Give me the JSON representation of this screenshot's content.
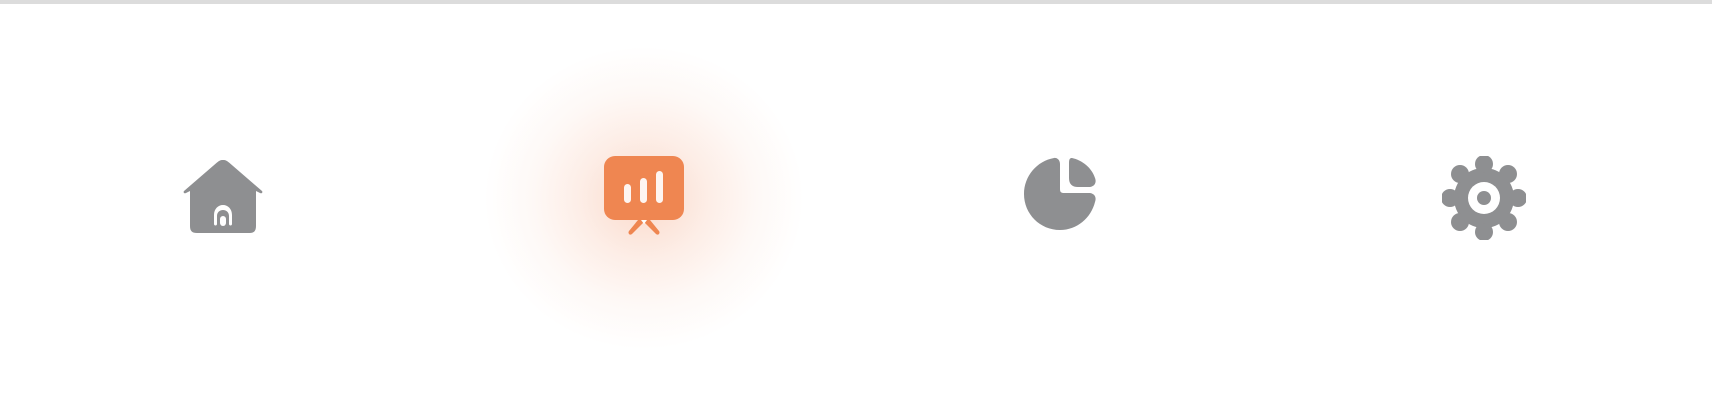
{
  "colors": {
    "inactive_icon": "#8e8f91",
    "active_icon": "#ef8651",
    "divider": "#dcdcdc",
    "background": "#ffffff"
  },
  "tab_bar": {
    "active_tab": "presentation",
    "tabs": [
      {
        "id": "home",
        "icon": "home-icon",
        "active": false
      },
      {
        "id": "presentation",
        "icon": "presentation-chart-icon",
        "active": true
      },
      {
        "id": "analytics",
        "icon": "pie-chart-icon",
        "active": false
      },
      {
        "id": "settings",
        "icon": "gear-icon",
        "active": false
      }
    ]
  }
}
